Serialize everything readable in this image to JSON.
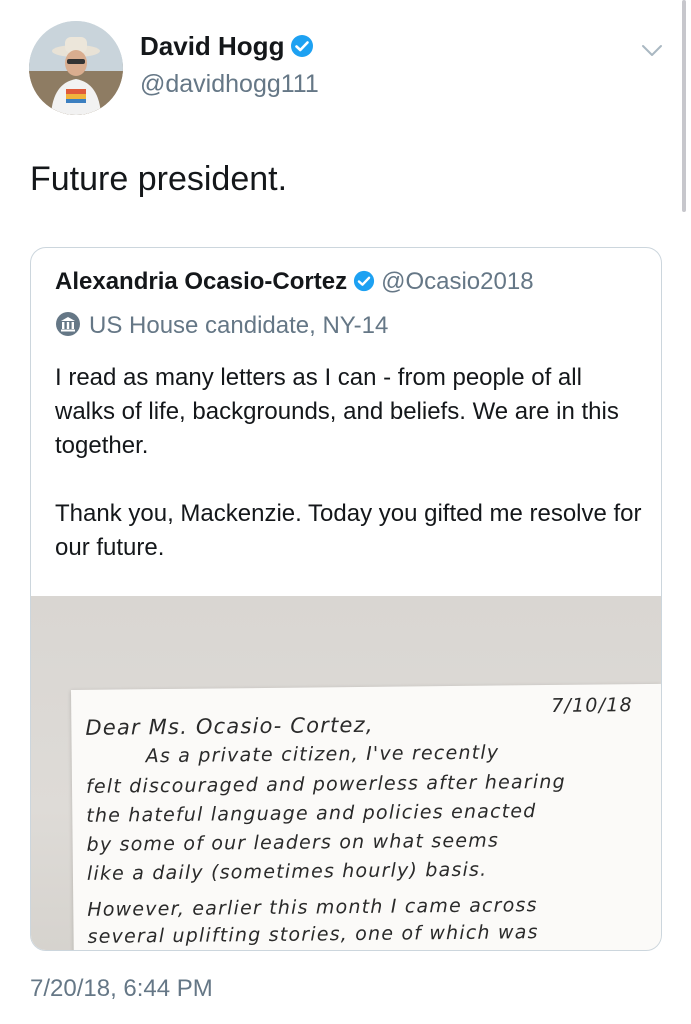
{
  "tweet": {
    "author": {
      "name": "David Hogg",
      "handle": "@davidhogg111",
      "verified": true
    },
    "text": "Future president.",
    "timestamp": "7/20/18, 6:44 PM",
    "quoted": {
      "author": {
        "name": "Alexandria Ocasio-Cortez",
        "handle": "@Ocasio2018",
        "verified": true
      },
      "label": "US House candidate, NY-14",
      "paragraphs": [
        "I read as many letters as I can - from people of all walks of life, backgrounds, and beliefs. We are in this together.",
        "Thank you, Mackenzie. Today you gifted me resolve for our future."
      ],
      "letter": {
        "date": "7/10/18",
        "lines": [
          "Dear Ms. Ocasio- Cortez,",
          "As a private citizen, I've recently",
          "felt discouraged and powerless after hearing",
          "the hateful language and policies enacted",
          "by some of our leaders on what seems",
          "like a daily (sometimes hourly) basis.",
          "However, earlier this month I came across",
          "several uplifting stories, one of which was"
        ]
      }
    }
  },
  "colors": {
    "verified": "#1da1f2",
    "secondary_text": "#657786",
    "primary_text": "#14171a",
    "border": "#ccd6dd"
  },
  "icons": {
    "verified": "verified-badge-icon",
    "more": "chevron-down-icon",
    "label": "government-building-icon"
  }
}
